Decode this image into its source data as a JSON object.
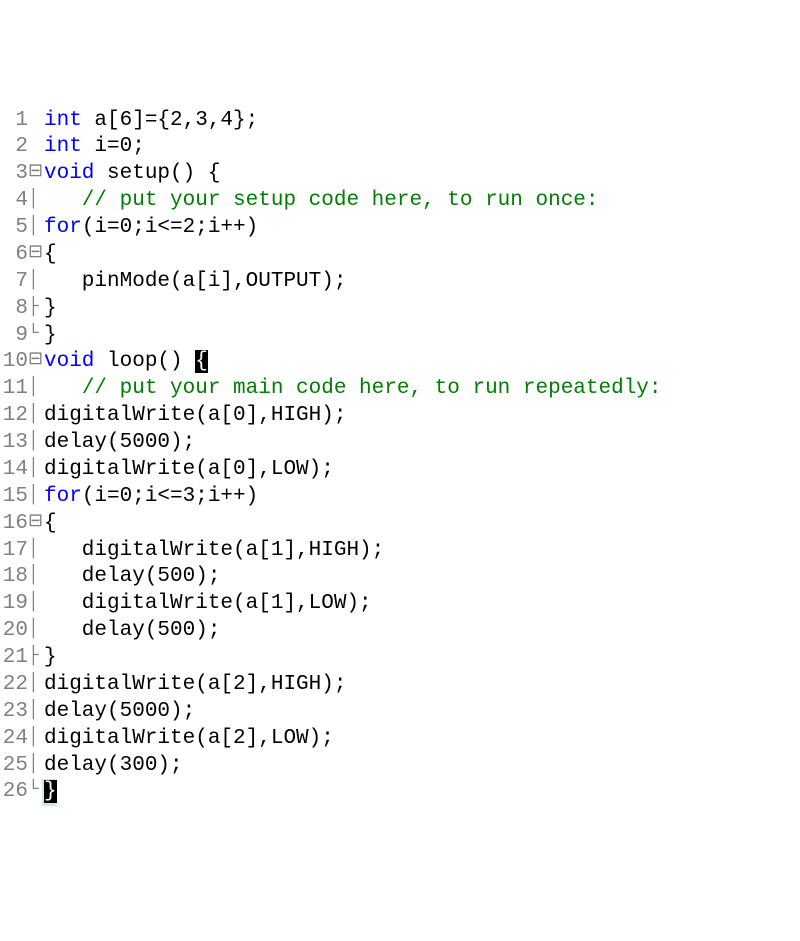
{
  "lines": [
    {
      "num": "1",
      "fold": " ",
      "seg": [
        [
          "kw",
          "int"
        ],
        [
          "",
          " a[6]={2,3,4};"
        ]
      ]
    },
    {
      "num": "2",
      "fold": " ",
      "seg": [
        [
          "kw",
          "int"
        ],
        [
          "",
          " i=0;"
        ]
      ]
    },
    {
      "num": "3",
      "fold": "⊟",
      "seg": [
        [
          "kw",
          "void"
        ],
        [
          "",
          " setup() {"
        ]
      ]
    },
    {
      "num": "4",
      "fold": "│",
      "seg": [
        [
          "",
          "   "
        ],
        [
          "cm",
          "// put your setup code here, to run once:"
        ]
      ]
    },
    {
      "num": "5",
      "fold": "│",
      "seg": [
        [
          "kw",
          "for"
        ],
        [
          "",
          "(i=0;i<=2;i++)"
        ]
      ]
    },
    {
      "num": "6",
      "fold": "⊟",
      "seg": [
        [
          "",
          "{"
        ]
      ]
    },
    {
      "num": "7",
      "fold": "│",
      "seg": [
        [
          "",
          "   pinMode(a[i],OUTPUT);"
        ]
      ]
    },
    {
      "num": "8",
      "fold": "├",
      "seg": [
        [
          "",
          "}"
        ]
      ]
    },
    {
      "num": "9",
      "fold": "└",
      "seg": [
        [
          "",
          "}"
        ]
      ]
    },
    {
      "num": "10",
      "fold": "⊟",
      "seg": [
        [
          "kw",
          "void"
        ],
        [
          "",
          " loop() "
        ],
        [
          "cursor",
          "{"
        ]
      ]
    },
    {
      "num": "11",
      "fold": "│",
      "seg": [
        [
          "",
          "   "
        ],
        [
          "cm",
          "// put your main code here, to run repeatedly:"
        ]
      ]
    },
    {
      "num": "12",
      "fold": "│",
      "seg": [
        [
          "",
          "digitalWrite(a[0],HIGH);"
        ]
      ]
    },
    {
      "num": "13",
      "fold": "│",
      "seg": [
        [
          "",
          "delay(5000);"
        ]
      ]
    },
    {
      "num": "14",
      "fold": "│",
      "seg": [
        [
          "",
          "digitalWrite(a[0],LOW);"
        ]
      ]
    },
    {
      "num": "15",
      "fold": "│",
      "seg": [
        [
          "kw",
          "for"
        ],
        [
          "",
          "(i=0;i<=3;i++)"
        ]
      ]
    },
    {
      "num": "16",
      "fold": "⊟",
      "seg": [
        [
          "",
          "{"
        ]
      ]
    },
    {
      "num": "17",
      "fold": "│",
      "seg": [
        [
          "",
          "   digitalWrite(a[1],HIGH);"
        ]
      ]
    },
    {
      "num": "18",
      "fold": "│",
      "seg": [
        [
          "",
          "   delay(500);"
        ]
      ]
    },
    {
      "num": "19",
      "fold": "│",
      "seg": [
        [
          "",
          "   digitalWrite(a[1],LOW);"
        ]
      ]
    },
    {
      "num": "20",
      "fold": "│",
      "seg": [
        [
          "",
          "   delay(500);"
        ]
      ]
    },
    {
      "num": "21",
      "fold": "├",
      "seg": [
        [
          "",
          "}"
        ]
      ]
    },
    {
      "num": "22",
      "fold": "│",
      "seg": [
        [
          "",
          "digitalWrite(a[2],HIGH);"
        ]
      ]
    },
    {
      "num": "23",
      "fold": "│",
      "seg": [
        [
          "",
          "delay(5000);"
        ]
      ]
    },
    {
      "num": "24",
      "fold": "│",
      "seg": [
        [
          "",
          "digitalWrite(a[2],LOW);"
        ]
      ]
    },
    {
      "num": "25",
      "fold": "│",
      "seg": [
        [
          "",
          "delay(300);"
        ]
      ]
    },
    {
      "num": "26",
      "fold": "└",
      "seg": [
        [
          "cursor",
          "}"
        ]
      ],
      "hl": true
    }
  ]
}
